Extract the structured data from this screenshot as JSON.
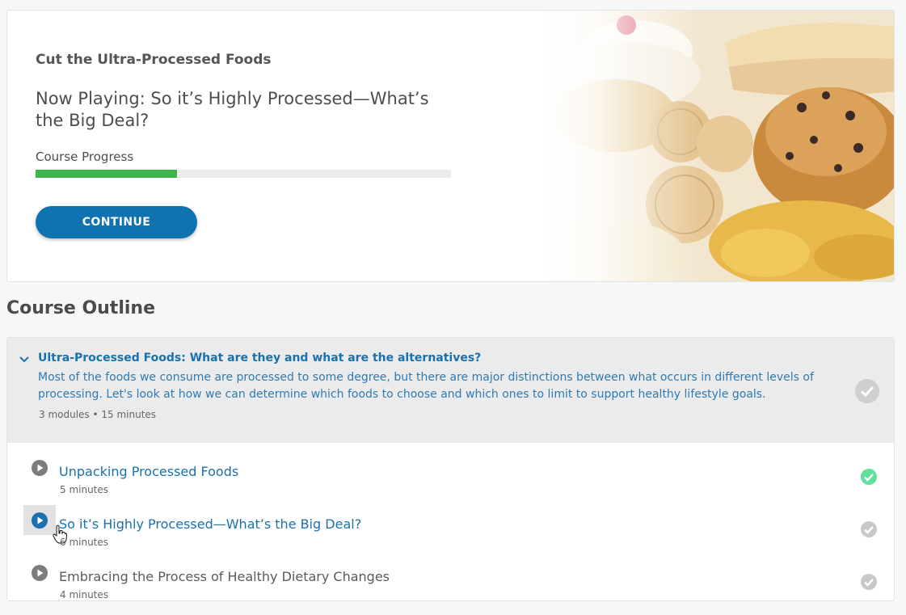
{
  "hero": {
    "course_title": "Cut the Ultra-Processed Foods",
    "now_playing": "Now Playing: So it’s Highly Processed—What’s the Big Deal?",
    "progress_label": "Course Progress",
    "progress_fraction": 0.34,
    "continue_label": "CONTINUE",
    "image": "baked-goods-and-snacks-photo"
  },
  "outline": {
    "heading": "Course Outline",
    "section": {
      "title": "Ultra-Processed Foods: What are they and what are the alternatives?",
      "description": "Most of the foods we consume are processed to some degree, but there are major distinctions between what occurs in different levels of processing. Let's look at how we can determine which foods to choose and which ones to limit to support healthy lifestyle goals.",
      "meta": "3 modules • 15 minutes",
      "icons": {
        "expand": "chevron-down-icon",
        "status": "check-circle-icon"
      }
    },
    "modules": [
      {
        "title": "Unpacking Processed Foods",
        "duration": "5 minutes",
        "completed": true
      },
      {
        "title": "So it’s Highly Processed—What’s the Big Deal?",
        "duration": "6 minutes",
        "completed": false,
        "current": true
      },
      {
        "title": "Embracing the Process of Healthy Dietary Changes",
        "duration": "4 minutes",
        "completed": false
      }
    ]
  },
  "colors": {
    "accent": "#1072b0",
    "link": "#1a71ad",
    "progress": "#3cb54a",
    "complete": "#5fe09b",
    "incomplete": "#c8c8c8"
  }
}
